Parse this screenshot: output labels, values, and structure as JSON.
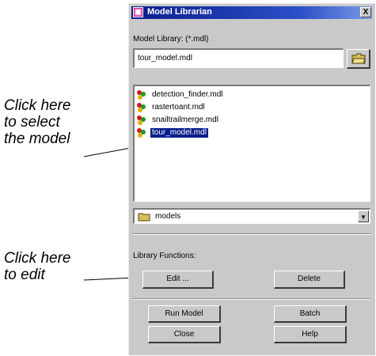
{
  "annotations": {
    "select_lines": [
      "Click here",
      "to select",
      "the model"
    ],
    "edit_lines": [
      "Click here",
      "to edit"
    ]
  },
  "window": {
    "title": "Model Librarian",
    "close_glyph": "X",
    "icon": "imagine-app-icon"
  },
  "library": {
    "label": "Model Library: (*.mdl)",
    "file_value": "tour_model.mdl",
    "browse_icon": "folder-open-icon",
    "items": [
      {
        "label": "detection_finder.mdl",
        "selected": false
      },
      {
        "label": "rastertoant.mdl",
        "selected": false
      },
      {
        "label": "snailtrailmerge.mdl",
        "selected": false
      },
      {
        "label": "tour_model.mdl",
        "selected": true
      }
    ],
    "directory": "models"
  },
  "functions": {
    "label": "Library Functions:",
    "edit_label": "Edit ...",
    "delete_label": "Delete"
  },
  "buttons": {
    "run_model": "Run Model",
    "batch": "Batch",
    "close": "Close",
    "help": "Help"
  }
}
